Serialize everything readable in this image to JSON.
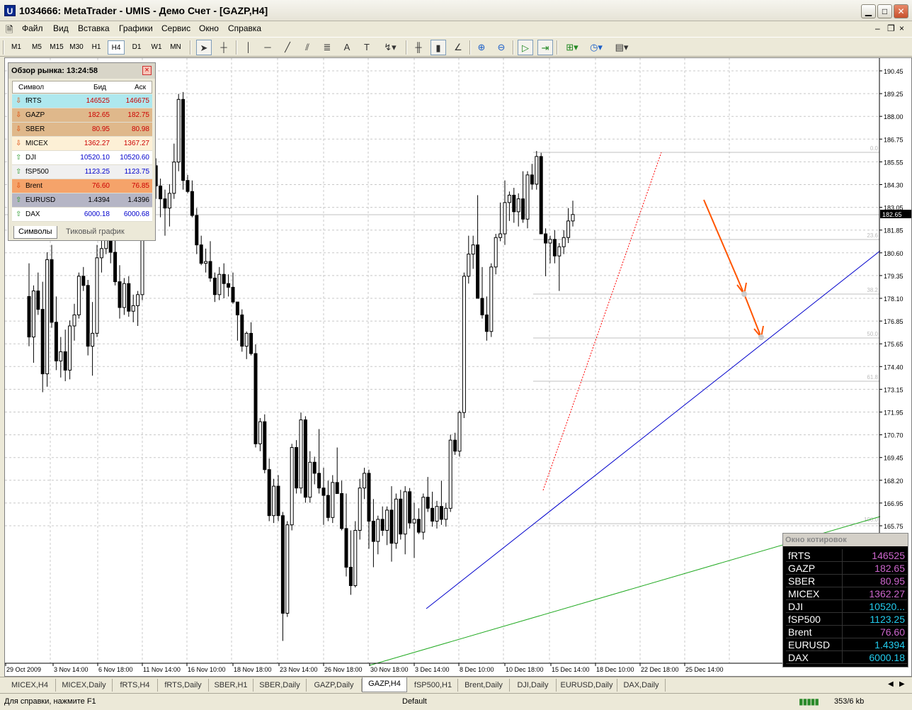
{
  "window": {
    "title": "1034666: MetaTrader - UMIS - Демо Счет - [GAZP,H4]",
    "icon": "U"
  },
  "menu": [
    "Файл",
    "Вид",
    "Вставка",
    "Графики",
    "Сервис",
    "Окно",
    "Справка"
  ],
  "timeframes": [
    "M1",
    "M5",
    "M15",
    "M30",
    "H1",
    "H4",
    "D1",
    "W1",
    "MN"
  ],
  "active_timeframe": "H4",
  "chart": {
    "symbol": "GAZP,H4",
    "price_labels": [
      "190.45",
      "189.25",
      "188.00",
      "186.75",
      "185.55",
      "184.30",
      "183.05",
      "181.85",
      "180.60",
      "179.35",
      "178.10",
      "176.85",
      "175.65",
      "174.40",
      "173.15",
      "171.95",
      "170.70",
      "169.45",
      "168.20",
      "166.95",
      "165.75"
    ],
    "current_price": "182.65",
    "fib_labels": [
      "0.0",
      "23.6",
      "38.2",
      "50.0",
      "61.8",
      "100.0"
    ],
    "time_labels": [
      "29 Oct 2009",
      "3 Nov 14:00",
      "6 Nov 18:00",
      "11 Nov 14:00",
      "16 Nov 10:00",
      "18 Nov 18:00",
      "23 Nov 14:00",
      "26 Nov 18:00",
      "30 Nov 18:00",
      "3 Dec 14:00",
      "8 Dec 10:00",
      "10 Dec 18:00",
      "15 Dec 14:00",
      "18 Dec 10:00",
      "22 Dec 18:00",
      "25 Dec 14:00"
    ],
    "colors": {
      "up": "#ffffff",
      "down": "#000000",
      "trend_blue": "#0000cc",
      "trend_green": "#22aa22",
      "fib": "#c0c0c0",
      "arrow": "#ff5500",
      "fib_dash": "#ff0000"
    }
  },
  "market_watch": {
    "title": "Обзор рынка: 13:24:58",
    "headers": {
      "symbol": "Символ",
      "bid": "Бид",
      "ask": "Аск"
    },
    "rows": [
      {
        "symbol": "fRTS",
        "bid": "146525",
        "ask": "146675",
        "dir": "down",
        "bg": "#aee8ee",
        "color": "#cc0000"
      },
      {
        "symbol": "GAZP",
        "bid": "182.65",
        "ask": "182.75",
        "dir": "down",
        "bg": "#dfb88b",
        "color": "#cc0000"
      },
      {
        "symbol": "SBER",
        "bid": "80.95",
        "ask": "80.98",
        "dir": "down",
        "bg": "#dfb88b",
        "color": "#cc0000"
      },
      {
        "symbol": "MICEX",
        "bid": "1362.27",
        "ask": "1367.27",
        "dir": "down",
        "bg": "#fdf0d6",
        "color": "#cc0000"
      },
      {
        "symbol": "DJI",
        "bid": "10520.10",
        "ask": "10520.60",
        "dir": "up",
        "bg": "#ffffff",
        "color": "#0000cc"
      },
      {
        "symbol": "fSP500",
        "bid": "1123.25",
        "ask": "1123.75",
        "dir": "up",
        "bg": "#f0f0f0",
        "color": "#0000cc"
      },
      {
        "symbol": "Brent",
        "bid": "76.60",
        "ask": "76.85",
        "dir": "down",
        "bg": "#f5a36a",
        "color": "#cc0000"
      },
      {
        "symbol": "EURUSD",
        "bid": "1.4394",
        "ask": "1.4396",
        "dir": "up",
        "bg": "#b5b5c5",
        "color": "#000000"
      },
      {
        "symbol": "DAX",
        "bid": "6000.18",
        "ask": "6000.68",
        "dir": "up",
        "bg": "#ffffff",
        "color": "#0000cc"
      }
    ],
    "tabs": [
      "Символы",
      "Тиковый график"
    ]
  },
  "quotes_window": {
    "title": "Окно котировок",
    "rows": [
      {
        "symbol": "fRTS",
        "value": "146525",
        "color": "#cc66cc"
      },
      {
        "symbol": "GAZP",
        "value": "182.65",
        "color": "#cc66cc"
      },
      {
        "symbol": "SBER",
        "value": "80.95",
        "color": "#cc66cc"
      },
      {
        "symbol": "MICEX",
        "value": "1362.27",
        "color": "#cc66cc"
      },
      {
        "symbol": "DJI",
        "value": "10520...",
        "color": "#22ccee"
      },
      {
        "symbol": "fSP500",
        "value": "1123.25",
        "color": "#22ccee"
      },
      {
        "symbol": "Brent",
        "value": "76.60",
        "color": "#cc66cc"
      },
      {
        "symbol": "EURUSD",
        "value": "1.4394",
        "color": "#22ccee"
      },
      {
        "symbol": "DAX",
        "value": "6000.18",
        "color": "#22ccee"
      }
    ]
  },
  "chart_tabs": [
    "MICEX,H4",
    "MICEX,Daily",
    "fRTS,H4",
    "fRTS,Daily",
    "SBER,H1",
    "SBER,Daily",
    "GAZP,Daily",
    "GAZP,H4",
    "fSP500,H1",
    "Brent,Daily",
    "DJI,Daily",
    "EURUSD,Daily",
    "DAX,Daily"
  ],
  "active_chart_tab": "GAZP,H4",
  "status": {
    "help": "Для справки, нажмите F1",
    "profile": "Default",
    "traffic": "353/6 kb"
  }
}
